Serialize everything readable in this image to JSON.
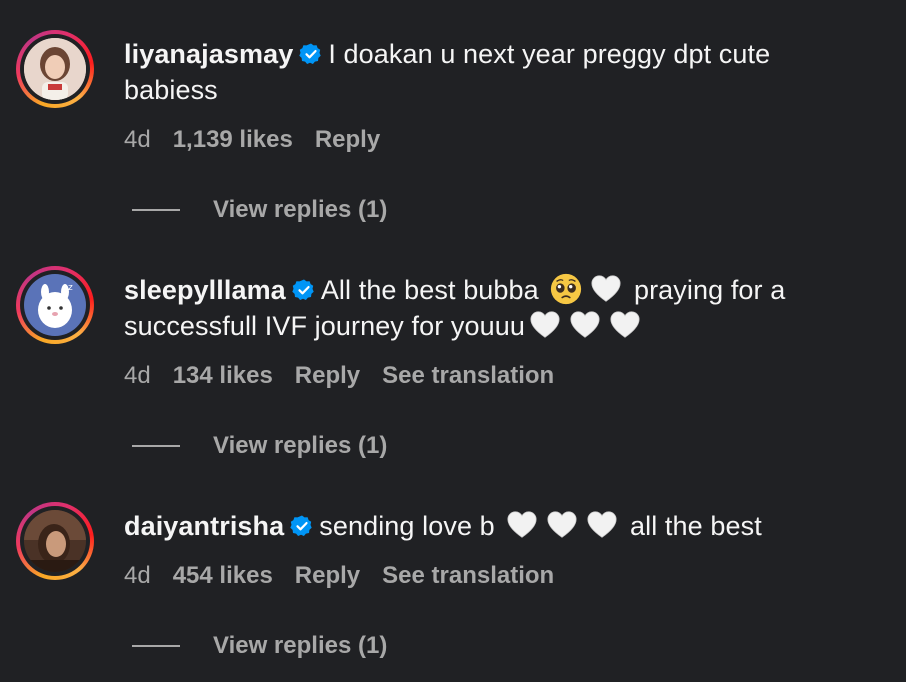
{
  "comments": [
    {
      "username": "liyanajasmay",
      "verified": true,
      "text": "I doakan u next year preggy dpt cute babiess",
      "time": "4d",
      "likes": "1,139 likes",
      "reply_label": "Reply",
      "translation_label": null,
      "view_replies_label": "View replies (1)"
    },
    {
      "username": "sleepylllama",
      "verified": true,
      "text_part1": "All the best bubba ",
      "text_part2": " praying for a successfull IVF journey for youuu",
      "time": "4d",
      "likes": "134 likes",
      "reply_label": "Reply",
      "translation_label": "See translation",
      "view_replies_label": "View replies (1)"
    },
    {
      "username": "daiyantrisha",
      "verified": true,
      "text_part1": "sending love b ",
      "text_part2": " all the best",
      "time": "4d",
      "likes": "454 likes",
      "reply_label": "Reply",
      "translation_label": "See translation",
      "view_replies_label": "View replies (1)"
    }
  ],
  "colors": {
    "background": "#202124",
    "primary_text": "#f5f5f5",
    "secondary_text": "#a8a8a8",
    "verified_badge": "#0095f6",
    "white_heart": "#f2f2f2"
  },
  "icons": [
    "verified-badge-icon",
    "white-heart-emoji",
    "pleading-face-emoji"
  ]
}
